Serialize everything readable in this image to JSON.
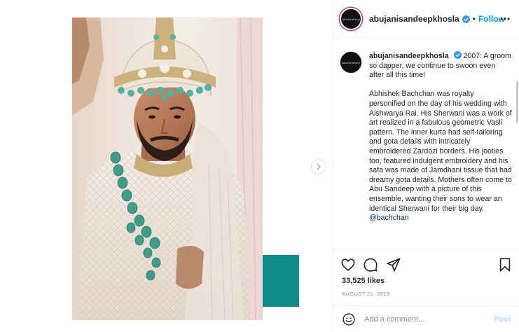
{
  "post": {
    "username": "abujanisandeepkhosla",
    "verified_icon": "verified-badge-icon",
    "separator": "•",
    "follow_label": "Follow",
    "more_icon": "more-options-icon",
    "avatar_text": "abujanisandeepkhosla"
  },
  "media": {
    "image_description_icon": "groom-portrait-photo",
    "next_icon": "chevron-right-icon",
    "accent_color": "#0e8a8a"
  },
  "caption": {
    "username": "abujanisandeepkhosla",
    "intro": "2007: A groom so dapper, we continue to swoon even after all this time!",
    "body": "Abhishek Bachchan was royalty personified on the day of his wedding with Aishwarya Rai. His Sherwani was a work of art realized in a fabulous geometric Vasli pattern. The inner kurta had self-tailoring and gota details with intricately embroidered Zardozi borders. His jooties too, featured indulgent embroidery and his safa was made of Jamdhani tissue that had dreamy gota details. Mothers often come to Abu Sandeep with a picture of this ensemble, wanting their sons to wear an identical Sherwani for their big day.",
    "mention": "@bachchan"
  },
  "actions": {
    "like_icon": "heart-icon",
    "comment_icon": "comment-icon",
    "share_icon": "share-icon",
    "save_icon": "bookmark-icon"
  },
  "stats": {
    "likes": "33,525 likes",
    "date": "AUGUST 21, 2019"
  },
  "comment_box": {
    "emoji_icon": "smiley-icon",
    "placeholder": "Add a comment...",
    "post_label": "Post"
  },
  "colors": {
    "link_blue": "#0095f6",
    "verified_blue": "#3897f0",
    "post_disabled": "#b2dffc",
    "teal_card": "#0e8a8a"
  }
}
